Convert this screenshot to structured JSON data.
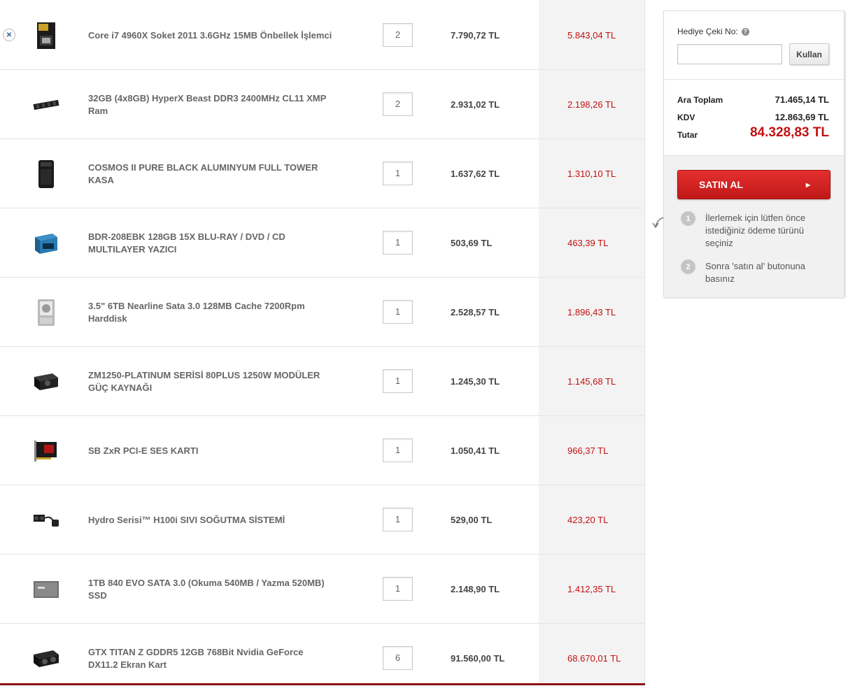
{
  "cart": {
    "remove_icon": "close-icon",
    "items": [
      {
        "name": "Core i7 4960X Soket 2011 3.6GHz 15MB Önbellek İşlemci",
        "qty": "2",
        "price": "7.790,72 TL",
        "discount_price": "5.843,04 TL",
        "icon": "cpu-box-icon"
      },
      {
        "name": "32GB (4x8GB) HyperX Beast DDR3 2400MHz CL11 XMP Ram",
        "qty": "2",
        "price": "2.931,02 TL",
        "discount_price": "2.198,26 TL",
        "icon": "ram-icon"
      },
      {
        "name": "COSMOS II PURE BLACK ALUMINYUM FULL TOWER KASA",
        "qty": "1",
        "price": "1.637,62 TL",
        "discount_price": "1.310,10 TL",
        "icon": "pc-case-icon"
      },
      {
        "name": "BDR-208EBK 128GB 15X BLU-RAY / DVD / CD MULTILAYER YAZICI",
        "qty": "1",
        "price": "503,69 TL",
        "discount_price": "463,39 TL",
        "icon": "bluray-box-icon"
      },
      {
        "name": "3.5\" 6TB Nearline Sata 3.0 128MB Cache 7200Rpm Harddisk",
        "qty": "1",
        "price": "2.528,57 TL",
        "discount_price": "1.896,43 TL",
        "icon": "hdd-icon"
      },
      {
        "name": "ZM1250-PLATINUM SERİSİ 80PLUS 1250W MODÜLER GÜÇ KAYNAĞI",
        "qty": "1",
        "price": "1.245,30 TL",
        "discount_price": "1.145,68 TL",
        "icon": "psu-icon"
      },
      {
        "name": "SB ZxR PCI-E SES KARTI",
        "qty": "1",
        "price": "1.050,41 TL",
        "discount_price": "966,37 TL",
        "icon": "sound-card-icon"
      },
      {
        "name": "Hydro Serisi™ H100i SIVI SOĞUTMA SİSTEMİ",
        "qty": "1",
        "price": "529,00 TL",
        "discount_price": "423,20 TL",
        "icon": "liquid-cooler-icon"
      },
      {
        "name": "1TB 840 EVO SATA 3.0 (Okuma 540MB / Yazma 520MB) SSD",
        "qty": "1",
        "price": "2.148,90 TL",
        "discount_price": "1.412,35 TL",
        "icon": "ssd-icon"
      },
      {
        "name": "GTX TITAN Z GDDR5 12GB 768Bit Nvidia GeForce DX11.2 Ekran Kart",
        "qty": "6",
        "price": "91.560,00 TL",
        "discount_price": "68.670,01 TL",
        "icon": "gpu-icon"
      }
    ]
  },
  "summary": {
    "gift_label": "Hediye Çeki No:",
    "help_icon": "help-icon",
    "gift_input_value": "",
    "apply_label": "Kullan",
    "subtotal_label": "Ara Toplam",
    "subtotal_value": "71.465,14 TL",
    "tax_label": "KDV",
    "tax_value": "12.863,69 TL",
    "total_label": "Tutar",
    "total_value": "84.328,83 TL",
    "buy_label": "SATIN AL",
    "buy_arrow": "▶",
    "steps": [
      {
        "num": "1",
        "text": "İlerlemek için lütfen önce istediğiniz ödeme türünü seçiniz"
      },
      {
        "num": "2",
        "text": "Sonra 'satın al' butonuna basınız"
      }
    ]
  },
  "colors": {
    "accent_red": "#c41010",
    "button_red": "#d42222",
    "price_column_bg": "#f3f3f3"
  }
}
